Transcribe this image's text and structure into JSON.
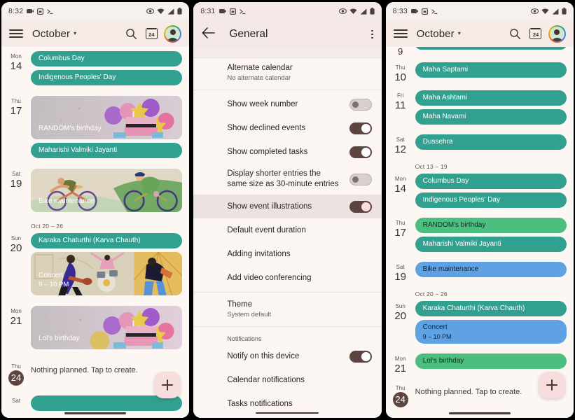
{
  "panels": {
    "left": {
      "status": {
        "time": "8:32",
        "icons": [
          "screen-record-icon",
          "screenshot-icon",
          "terminal-icon",
          "visibility-icon",
          "wifi-icon",
          "signal-icon",
          "battery-icon"
        ]
      },
      "appbar": {
        "menu": "menu-icon",
        "title": "October",
        "caret": "▾",
        "search": "search-icon",
        "today_number": "24",
        "avatar": "user-avatar"
      },
      "days": [
        {
          "dow": "Mon",
          "num": "14",
          "today": false,
          "events": [
            {
              "kind": "chip",
              "color": "teal",
              "title": "Columbus Day"
            },
            {
              "kind": "chip",
              "color": "teal",
              "title": "Indigenous Peoples' Day"
            }
          ]
        },
        {
          "dow": "Thu",
          "num": "17",
          "today": false,
          "events": [
            {
              "kind": "illustration",
              "art": "birthday",
              "title": "RANDOM's birthday"
            },
            {
              "kind": "chip",
              "color": "teal",
              "title": "Maharishi Valmiki Jayanti"
            }
          ]
        },
        {
          "dow": "Sat",
          "num": "19",
          "today": false,
          "events": [
            {
              "kind": "illustration",
              "art": "bike",
              "title": "Bike maintenance"
            }
          ]
        }
      ],
      "week_label": "Oct 20 – 26",
      "days2": [
        {
          "dow": "Sun",
          "num": "20",
          "today": false,
          "events": [
            {
              "kind": "chip",
              "color": "teal",
              "title": "Karaka Chaturthi (Karva Chauth)"
            },
            {
              "kind": "illustration",
              "art": "concert",
              "title": "Concert",
              "sub": "9 – 10 PM"
            }
          ]
        },
        {
          "dow": "Mon",
          "num": "21",
          "today": false,
          "events": [
            {
              "kind": "illustration",
              "art": "birthday",
              "title": "Lol's birthday"
            }
          ]
        },
        {
          "dow": "Thu",
          "num": "24",
          "today": true,
          "empty_text": "Nothing planned. Tap to create."
        }
      ],
      "fab": "add-event"
    },
    "middle": {
      "status": {
        "time": "8:31"
      },
      "appbar": {
        "back": "back-arrow-icon",
        "title": "General",
        "overflow": "more-options-icon"
      },
      "rows": [
        {
          "type": "two-line",
          "title": "Alternate calendar",
          "subtitle": "No alternate calendar"
        },
        {
          "type": "toggle",
          "title": "Show week number",
          "state": "off"
        },
        {
          "type": "toggle",
          "title": "Show declined events",
          "state": "on"
        },
        {
          "type": "toggle",
          "title": "Show completed tasks",
          "state": "on"
        },
        {
          "type": "toggle",
          "title": "Display shorter entries the same size as 30-minute entries",
          "state": "off"
        },
        {
          "type": "toggle",
          "title": "Show event illustrations",
          "state": "on",
          "highlighted": true,
          "thumb": "pink"
        },
        {
          "type": "single",
          "title": "Default event duration"
        },
        {
          "type": "single",
          "title": "Adding invitations"
        },
        {
          "type": "single",
          "title": "Add video conferencing"
        },
        {
          "type": "two-line",
          "title": "Theme",
          "subtitle": "System default"
        }
      ],
      "section_notifications": "Notifications",
      "rows2": [
        {
          "type": "toggle",
          "title": "Notify on this device",
          "state": "on"
        },
        {
          "type": "single",
          "title": "Calendar notifications"
        },
        {
          "type": "single",
          "title": "Tasks notifications"
        }
      ]
    },
    "right": {
      "status": {
        "time": "8:33"
      },
      "appbar": {
        "menu": "menu-icon",
        "title": "October",
        "caret": "▾",
        "search": "search-icon",
        "today_number": "24",
        "avatar": "user-avatar"
      },
      "partial_day": {
        "dow": "",
        "num": "9"
      },
      "days": [
        {
          "dow": "Thu",
          "num": "10",
          "events": [
            {
              "color": "teal",
              "title": "Maha Saptami"
            }
          ]
        },
        {
          "dow": "Fri",
          "num": "11",
          "events": [
            {
              "color": "teal",
              "title": "Maha Ashtami"
            },
            {
              "color": "teal",
              "title": "Maha Navami"
            }
          ]
        },
        {
          "dow": "Sat",
          "num": "12",
          "events": [
            {
              "color": "teal",
              "title": "Dussehra"
            }
          ]
        }
      ],
      "week_label1": "Oct 13 – 19",
      "days2": [
        {
          "dow": "Mon",
          "num": "14",
          "events": [
            {
              "color": "teal",
              "title": "Columbus Day"
            },
            {
              "color": "teal",
              "title": "Indigenous Peoples' Day"
            }
          ]
        },
        {
          "dow": "Thu",
          "num": "17",
          "events": [
            {
              "color": "green",
              "title": "RANDOM's birthday"
            },
            {
              "color": "teal",
              "title": "Maharishi Valmiki Jayanti"
            }
          ]
        },
        {
          "dow": "Sat",
          "num": "19",
          "events": [
            {
              "color": "blue",
              "title": "Bike maintenance"
            }
          ]
        }
      ],
      "week_label2": "Oct 20 – 26",
      "days3": [
        {
          "dow": "Sun",
          "num": "20",
          "events": [
            {
              "color": "teal",
              "title": "Karaka Chaturthi (Karva Chauth)"
            },
            {
              "color": "blue",
              "title": "Concert",
              "sub": "9 – 10 PM"
            }
          ]
        },
        {
          "dow": "Mon",
          "num": "21",
          "events": [
            {
              "color": "green",
              "title": "Lol's birthday"
            }
          ]
        },
        {
          "dow": "Thu",
          "num": "24",
          "today": true,
          "empty_text": "Nothing planned. Tap to create."
        }
      ],
      "fab": "add-event"
    }
  },
  "colors": {
    "holiday_teal": "#32a08f",
    "birthday_green": "#4cbe7f",
    "task_blue": "#5fa2e4",
    "app_bar": "#f7ebe8",
    "surface": "#fdf7f4",
    "today_circle": "#5d4440",
    "fab": "#f7ddde",
    "toggle_on": "#5d4440"
  }
}
